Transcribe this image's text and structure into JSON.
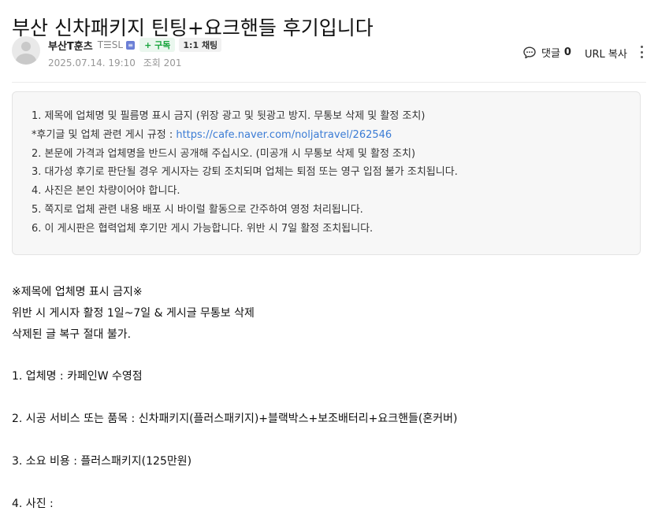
{
  "post": {
    "title": "부산 신차패키지 틴팅+요크핸들 후기입니다",
    "author": "부산T훈츠",
    "level": "T☰SL",
    "level_badge": "≡",
    "subscribe_label": "+ 구독",
    "chat_label": "1:1 채팅",
    "date": "2025.07.14. 19:10",
    "views": "조회 201",
    "comment_label": "댓글",
    "comment_count": "0",
    "url_copy_label": "URL 복사"
  },
  "notice": {
    "items": [
      "1. 제목에 업체명 및 필름명 표시 금지 (위장 광고 및 뒷광고 방지. 무통보 삭제 및 활정 조치)",
      "*후기글 및 업체 관련 게시 규정 : ",
      "2. 본문에 가격과 업체명을 반드시 공개해 주십시오. (미공개 시 무통보 삭제 및 활정 조치)",
      "3. 대가성 후기로 판단될 경우 게시자는 강퇴 조치되며 업체는 퇴점 또는 영구 입점 불가 조치됩니다.",
      "4. 사진은 본인 차량이어야 합니다.",
      "5. 쪽지로 업체 관련 내용 배포 시 바이럴 활동으로 간주하여 영정 처리됩니다.",
      "6. 이 게시판은 협력업체 후기만 게시 가능합니다. 위반 시 7일 활정 조치됩니다."
    ],
    "link": "https://cafe.naver.com/noljatravel/262546"
  },
  "content": {
    "warning_title": "※제목에 업체명 표시 금지※",
    "warning_line1": "위반 시 게시자 활정 1일~7일 & 게시글 무통보 삭제",
    "warning_line2": "삭제된 글 복구 절대 불가.",
    "business": "1. 업체명 :  카페인W 수영점",
    "service": "2. 시공 서비스 또는 품목 :  신차패키지(플러스패키지)+블랙박스+보조배터리+요크핸들(혼커버)",
    "cost": "3. 소요 비용 :  플러스패키지(125만원)",
    "photo": "4. 사진 :"
  }
}
